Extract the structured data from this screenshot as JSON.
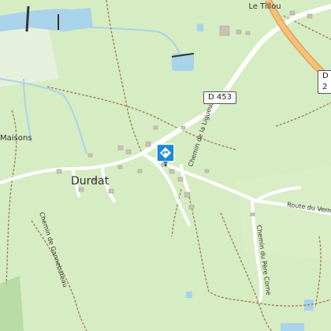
{
  "map": {
    "places": {
      "le_tillou": "Le Tillou",
      "durdat": "Durdat",
      "maisons": "Maisons"
    },
    "roads": {
      "d453": "D 453",
      "d2_partial": "D 2"
    },
    "paths": {
      "chemin_de_la_ligueuse": "Chemin de la Ligueuse",
      "chemin_de_gannebateau": "Chemin de Gannebateau",
      "chemin_du_pere_corne": "Chemin du Père Corne",
      "route_du_vernet": "Route du Vernet"
    },
    "marker_icon": "directions-icon",
    "colors": {
      "land": "#d6ecc2",
      "field": "#e4f2d4",
      "water": "#a9d3ea",
      "road": "#ffffff",
      "major_road": "#f6c277",
      "path": "#a07a4e",
      "marker": "#1b8ad8"
    }
  }
}
